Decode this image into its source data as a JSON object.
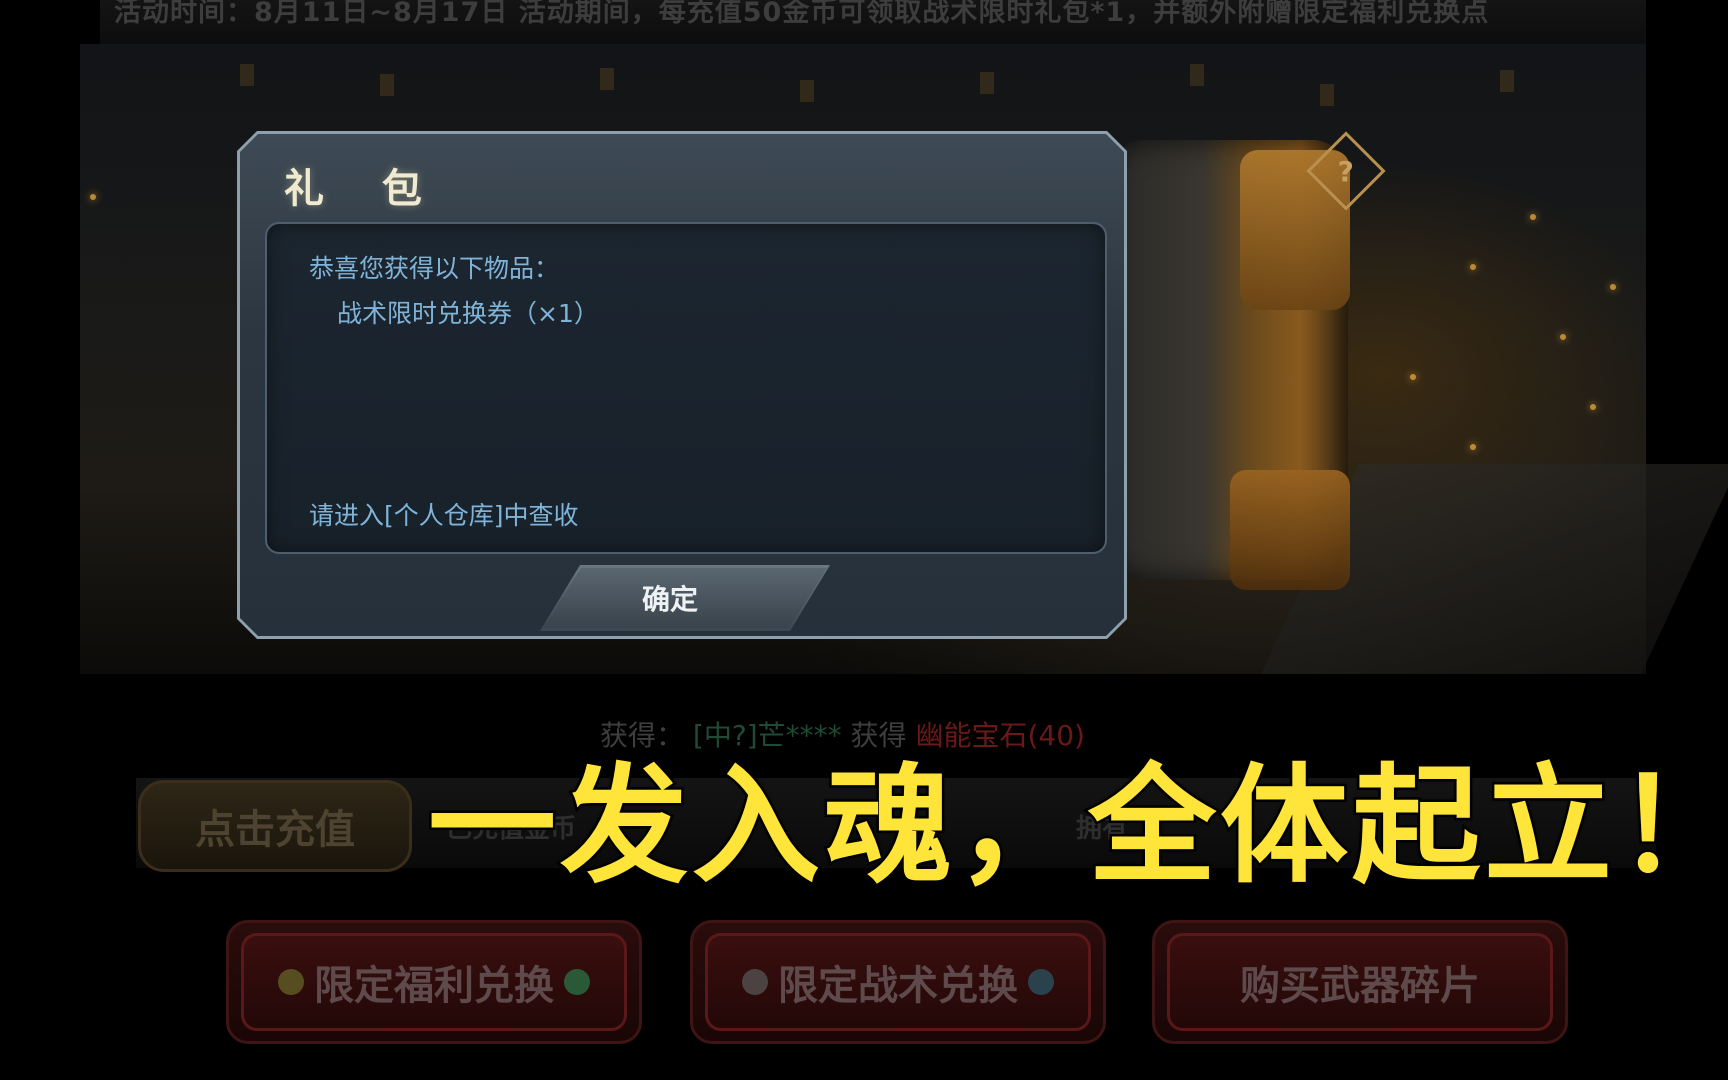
{
  "banner": {
    "text": "活动时间：8月11日~8月17日   活动期间，每充值50金币可领取战术限时礼包*1，并额外附赠限定福利兑换点"
  },
  "dialog": {
    "title": "礼 包",
    "intro": "恭喜您获得以下物品：",
    "item": "战术限时兑换券（×1）",
    "hint": "请进入[个人仓库]中查收",
    "confirm_label": "确定"
  },
  "scene": {
    "help_icon": "question-diamond-icon",
    "reward_prefix": "获得：",
    "reward_player": "[中?]芒****",
    "reward_verb": "获得",
    "reward_item": "幽能宝石(40)"
  },
  "recharge": {
    "button_label": "点击充值",
    "recharged_label": "已充值金币",
    "owned_label": "拥有"
  },
  "exchange_buttons": [
    {
      "label": "限定福利兑换",
      "icon": "green-gem-icon"
    },
    {
      "label": "限定战术兑换",
      "icon": "blue-gem-icon"
    },
    {
      "label": "购买武器碎片"
    }
  ],
  "caption": {
    "text": "一发入魂，全体起立！",
    "color": "#ffe53a"
  }
}
